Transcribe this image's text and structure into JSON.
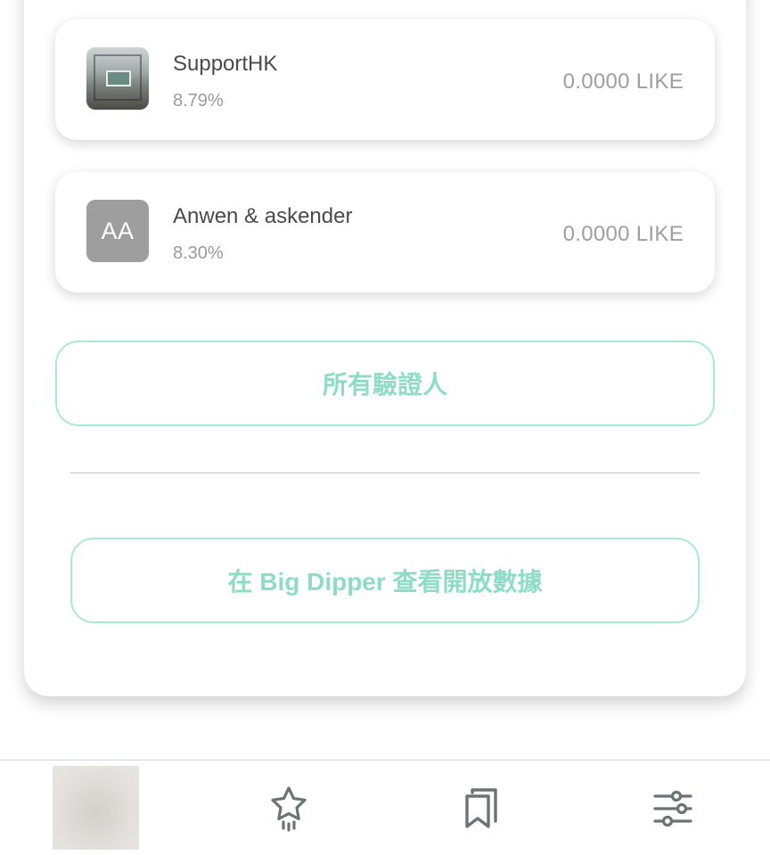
{
  "validators": [
    {
      "name": "SupportHK",
      "percentage": "8.79%",
      "amount": "0.0000 LIKE",
      "avatar": "photo"
    },
    {
      "name": "Anwen & askender",
      "percentage": "8.30%",
      "amount": "0.0000 LIKE",
      "avatar_initials": "AA"
    }
  ],
  "buttons": {
    "all_validators": "所有驗證人",
    "big_dipper": "在 Big Dipper 查看開放數據"
  },
  "bottom_nav": {
    "icons": [
      "thumbnail",
      "star-sparkle-icon",
      "bookmarks-icon",
      "sliders-icon"
    ]
  },
  "colors": {
    "accent": "#8fdcc6",
    "accent_border": "#a9e8d9",
    "name_text": "#4a4a4a",
    "muted_text": "#9e9e9e",
    "icon": "#6d7276"
  }
}
